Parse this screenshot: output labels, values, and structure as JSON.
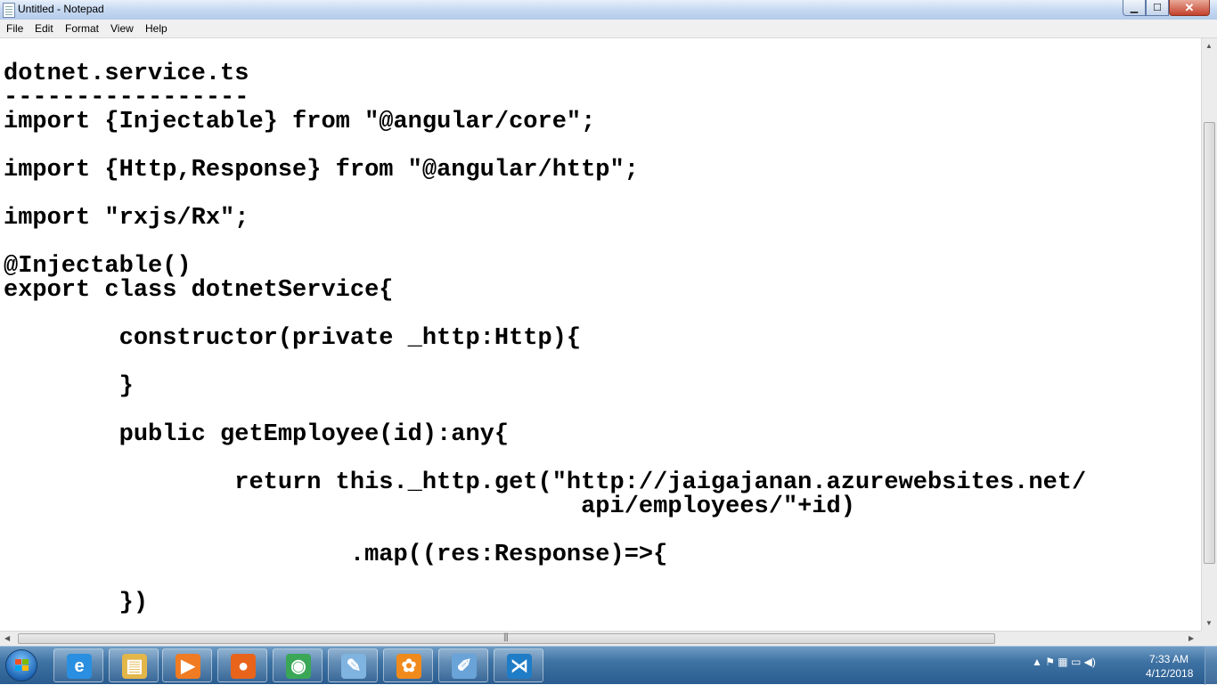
{
  "window": {
    "title": "Untitled - Notepad",
    "minimize_label": "▁",
    "maximize_label": "☐",
    "close_label": "✕"
  },
  "menu": [
    "File",
    "Edit",
    "Format",
    "View",
    "Help"
  ],
  "editor": {
    "lines": [
      "dotnet.service.ts",
      "-----------------",
      "import {Injectable} from \"@angular/core\";",
      "import {Http,Response} from \"@angular/http\";",
      "import \"rxjs/Rx\";",
      "@Injectable()",
      "export class dotnetService{",
      "        constructor(private _http:Http){",
      "        }",
      "        public getEmployee(id):any{",
      "                return this._http.get(\"http://jaigajanan.azurewebsites.net/",
      "                                        api/employees/\"+id)",
      "                        .map((res:Response)=>{",
      "        })"
    ]
  },
  "scrollbars": {
    "up_arrow": "▲",
    "down_arrow": "▼",
    "left_arrow": "◀",
    "right_arrow": "▶",
    "grip": "|||"
  },
  "taskbar": {
    "apps": [
      {
        "name": "internet-explorer",
        "glyph": "e",
        "color": "#2a8fe0"
      },
      {
        "name": "file-explorer",
        "glyph": "▤",
        "color": "#e3b64a"
      },
      {
        "name": "media-player",
        "glyph": "▶",
        "color": "#f07b22"
      },
      {
        "name": "firefox",
        "glyph": "●",
        "color": "#e8641b"
      },
      {
        "name": "chrome",
        "glyph": "◉",
        "color": "#3aa757"
      },
      {
        "name": "notepad",
        "glyph": "✎",
        "color": "#7fb3e0"
      },
      {
        "name": "flower-app",
        "glyph": "✿",
        "color": "#f08a1c"
      },
      {
        "name": "paint",
        "glyph": "✐",
        "color": "#6aa3d8"
      },
      {
        "name": "visual-studio-code",
        "glyph": "⋊",
        "color": "#1f7cc7"
      }
    ],
    "tray_icons": "▲  ⚑  ▦  ▭  ◀)",
    "clock_time": "7:33 AM",
    "clock_date": "4/12/2018"
  }
}
